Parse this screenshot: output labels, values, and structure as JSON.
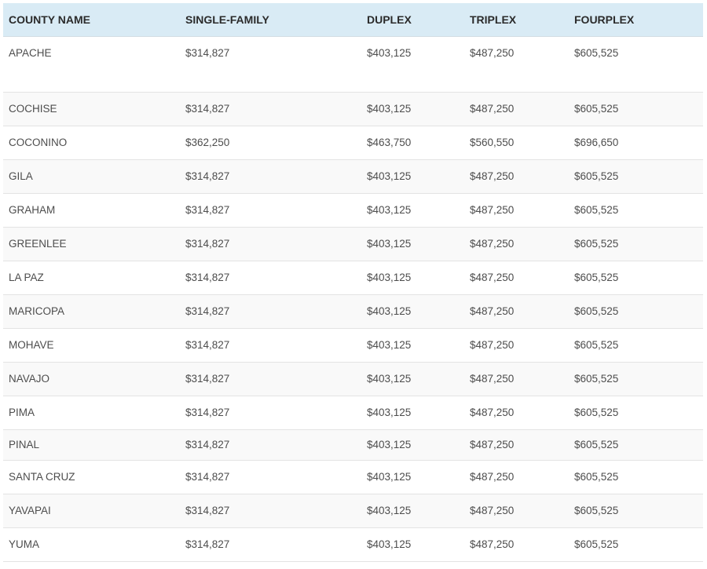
{
  "table": {
    "headers": [
      "COUNTY NAME",
      "SINGLE-FAMILY",
      "DUPLEX",
      "TRIPLEX",
      "FOURPLEX"
    ],
    "rows": [
      [
        "APACHE",
        "$314,827",
        "$403,125",
        "$487,250",
        "$605,525"
      ],
      [
        "COCHISE",
        "$314,827",
        "$403,125",
        "$487,250",
        "$605,525"
      ],
      [
        "COCONINO",
        "$362,250",
        "$463,750",
        "$560,550",
        "$696,650"
      ],
      [
        "GILA",
        "$314,827",
        "$403,125",
        "$487,250",
        "$605,525"
      ],
      [
        "GRAHAM",
        "$314,827",
        "$403,125",
        "$487,250",
        "$605,525"
      ],
      [
        "GREENLEE",
        "$314,827",
        "$403,125",
        "$487,250",
        "$605,525"
      ],
      [
        "LA PAZ",
        "$314,827",
        "$403,125",
        "$487,250",
        "$605,525"
      ],
      [
        "MARICOPA",
        "$314,827",
        "$403,125",
        "$487,250",
        "$605,525"
      ],
      [
        "MOHAVE",
        "$314,827",
        "$403,125",
        "$487,250",
        "$605,525"
      ],
      [
        "NAVAJO",
        "$314,827",
        "$403,125",
        "$487,250",
        "$605,525"
      ],
      [
        "PIMA",
        "$314,827",
        "$403,125",
        "$487,250",
        "$605,525"
      ],
      [
        "PINAL",
        "$314,827",
        "$403,125",
        "$487,250",
        "$605,525"
      ],
      [
        "SANTA CRUZ",
        "$314,827",
        "$403,125",
        "$487,250",
        "$605,525"
      ],
      [
        "YAVAPAI",
        "$314,827",
        "$403,125",
        "$487,250",
        "$605,525"
      ],
      [
        "YUMA",
        "$314,827",
        "$403,125",
        "$487,250",
        "$605,525"
      ]
    ]
  },
  "colors": {
    "header_bg": "#d9ebf5",
    "row_alt_bg": "#f9f9f9",
    "text": "#4d4d4d",
    "border": "#e3e3e3"
  }
}
